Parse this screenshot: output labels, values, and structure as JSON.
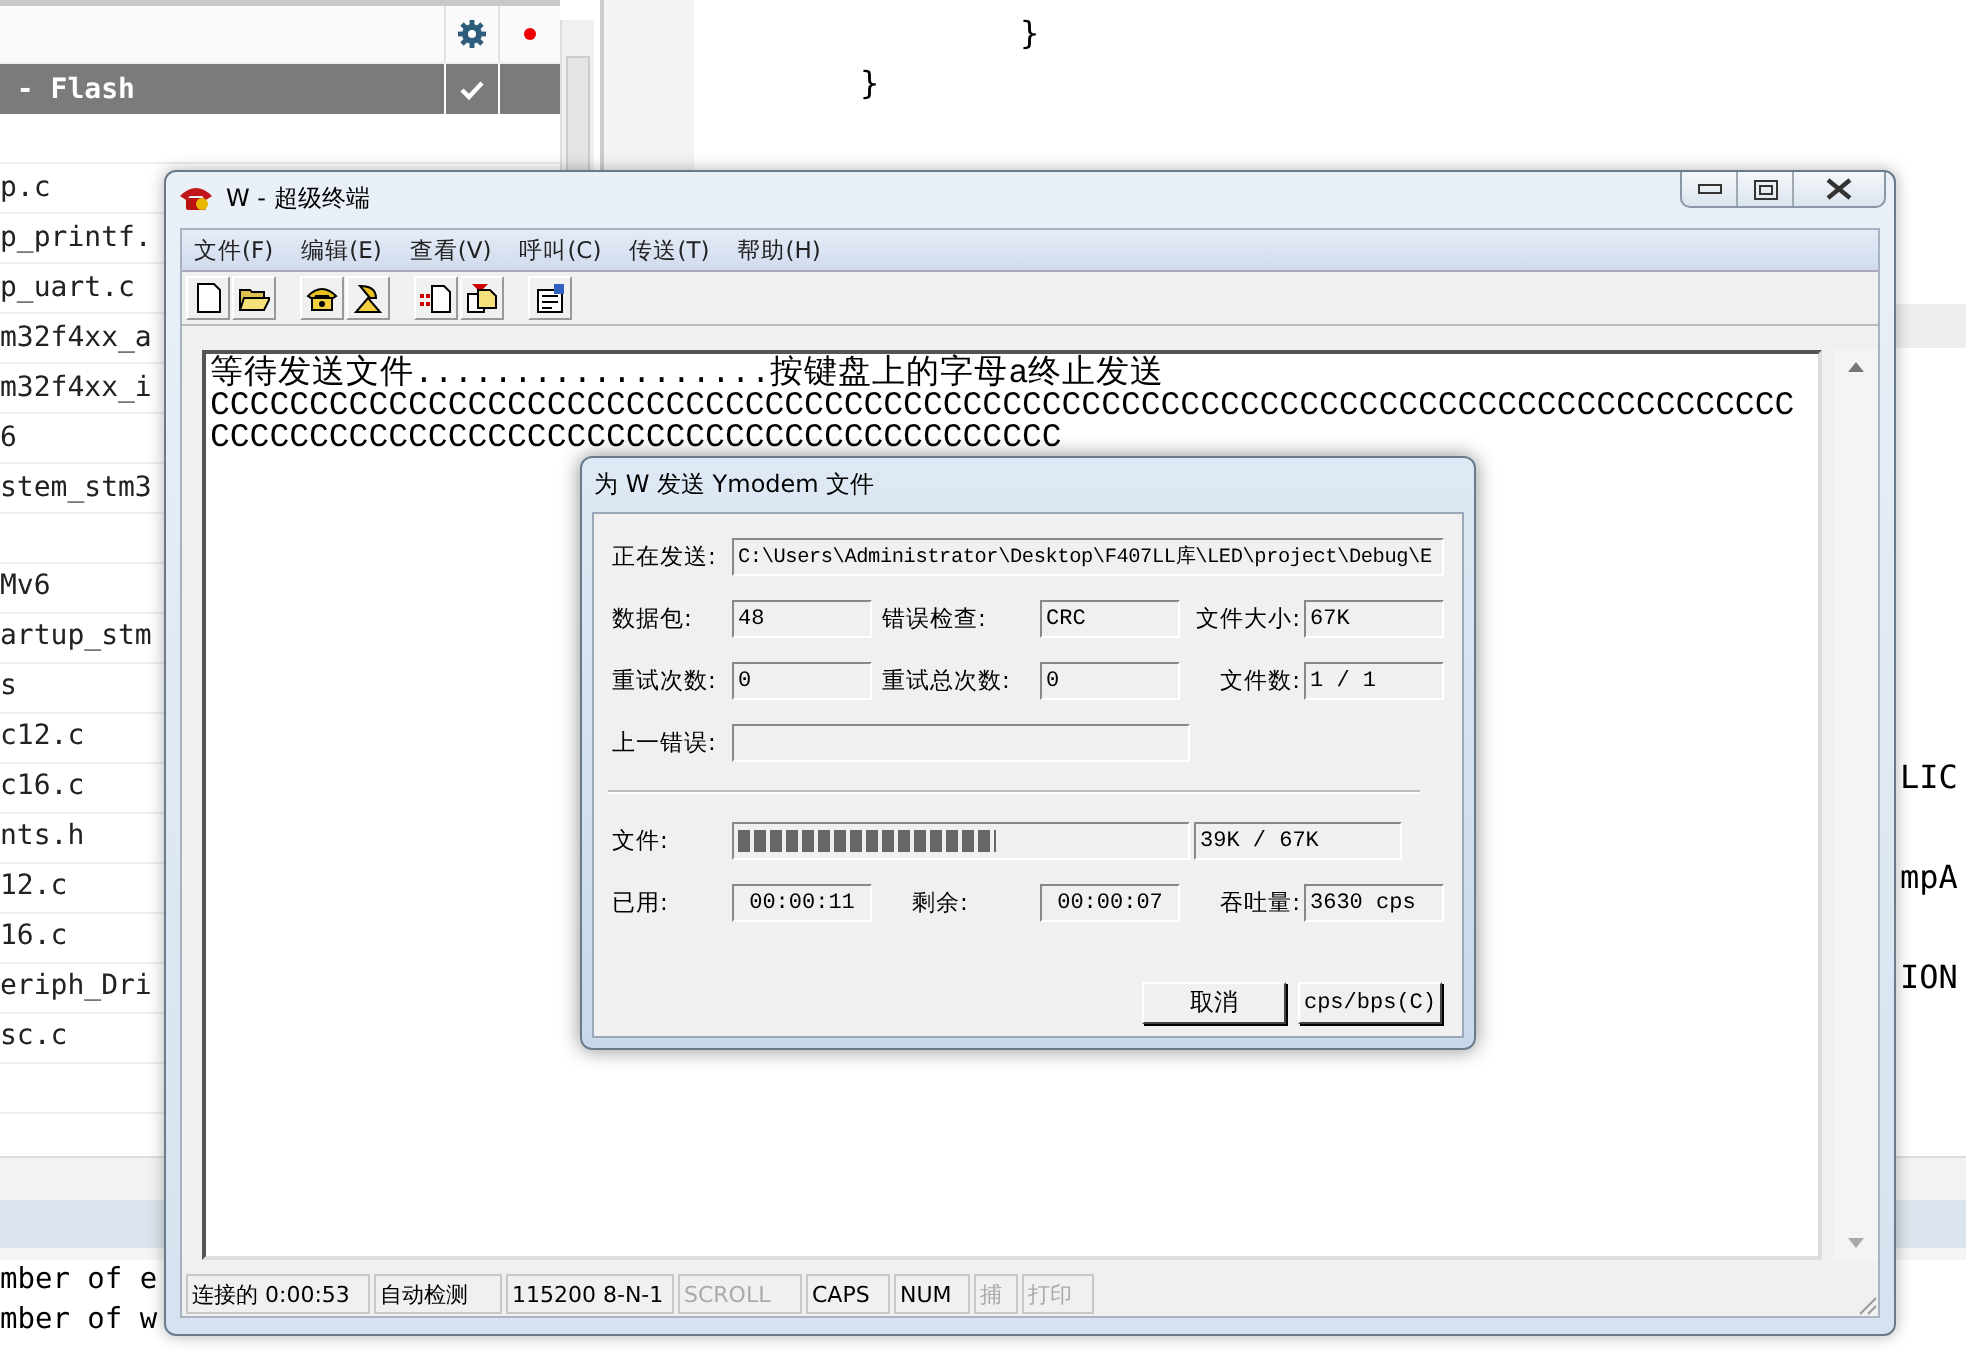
{
  "ide": {
    "file_panel": {
      "header": " - Flash",
      "header_checked": true,
      "items": [
        "p.c",
        "p_printf.",
        "p_uart.c",
        "m32f4xx_a",
        "m32f4xx_i",
        "6",
        "stem_stm3",
        "Mv6",
        "artup_stm",
        "s",
        "c12.c",
        "c16.c",
        "nts.h",
        "12.c",
        "16.c",
        "eriph_Dri",
        "sc.c"
      ]
    },
    "code_lines": [
      "}",
      "}"
    ],
    "right_fragments": [
      "LIC",
      "mpA",
      "ION"
    ],
    "output_lines": [
      "mber of e",
      "mber of w"
    ]
  },
  "terminal": {
    "title": "W - 超级终端",
    "menus": [
      "文件(F)",
      "编辑(E)",
      "查看(V)",
      "呼叫(C)",
      "传送(T)",
      "帮助(H)"
    ],
    "toolbar": [
      [
        {
          "kind": "new"
        },
        {
          "kind": "open"
        }
      ],
      [
        {
          "kind": "call"
        },
        {
          "kind": "hangup"
        }
      ],
      [
        {
          "kind": "send"
        },
        {
          "kind": "receive"
        }
      ],
      [
        {
          "kind": "properties"
        }
      ]
    ],
    "lines": [
      "等待发送文件..................按键盘上的字母a终止发送",
      "CCCCCCCCCCCCCCCCCCCCCCCCCCCCCCCCCCCCCCCCCCCCCCCCCCCCCCCCCCCCCCCCCCCCCCCCCCCCCCCC",
      "CCCCCCCCCCCCCCCCCCCCCCCCCCCCCCCCCCCCCCCCCCC"
    ],
    "status": [
      {
        "text": "连接的 0:00:53",
        "disabled": false
      },
      {
        "text": "自动检测",
        "disabled": false
      },
      {
        "text": "115200 8-N-1",
        "disabled": false
      },
      {
        "text": "SCROLL",
        "disabled": true
      },
      {
        "text": "CAPS",
        "disabled": false
      },
      {
        "text": "NUM",
        "disabled": false
      },
      {
        "text": "捕",
        "disabled": true
      },
      {
        "text": "打印",
        "disabled": true
      }
    ]
  },
  "dialog": {
    "title": "为 W 发送 Ymodem 文件",
    "sending": {
      "label": "正在发送:",
      "value": "C:\\Users\\Administrator\\Desktop\\F407LL库\\LED\\project\\Debug\\E"
    },
    "packet": {
      "label": "数据包:",
      "value": "48"
    },
    "error_check": {
      "label": "错误检查:",
      "value": "CRC"
    },
    "file_size": {
      "label": "文件大小:",
      "value": "67K"
    },
    "retries": {
      "label": "重试次数:",
      "value": "0"
    },
    "total_retries": {
      "label": "重试总次数:",
      "value": "0"
    },
    "files": {
      "label": "文件数:",
      "value": "1 / 1"
    },
    "last_error": {
      "label": "上一错误:"
    },
    "file": {
      "label": "文件:",
      "level": 0.58,
      "reading": "39K / 67K"
    },
    "elapsed": {
      "label": "已用:",
      "value": "00:00:11"
    },
    "remaining": {
      "label": "剩余:",
      "value": "00:00:07"
    },
    "throughput": {
      "label": "吞吐量:",
      "value": "3630 cps"
    },
    "buttons": [
      "取消",
      "cps/bps(C)"
    ]
  }
}
